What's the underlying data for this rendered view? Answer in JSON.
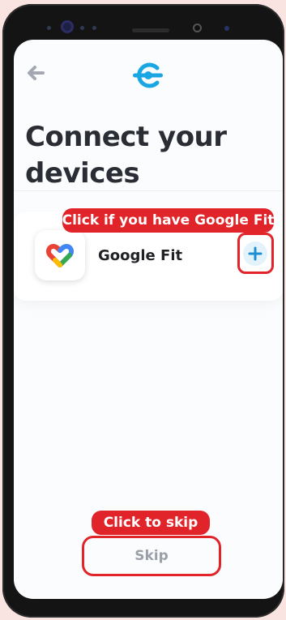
{
  "header": {
    "back_icon": "arrow-left-icon",
    "logo_icon": "connect-logo-icon",
    "logo_color": "#1aa6e2"
  },
  "page": {
    "title": "Connect your devices"
  },
  "devices": [
    {
      "name": "Google Fit",
      "icon": "google-fit-icon",
      "action_icon": "plus-icon"
    }
  ],
  "annotations": {
    "google_fit_hint": "Click if you have Google Fit",
    "skip_hint": "Click to skip",
    "highlight_color": "#e0242a"
  },
  "footer": {
    "skip_label": "Skip"
  }
}
